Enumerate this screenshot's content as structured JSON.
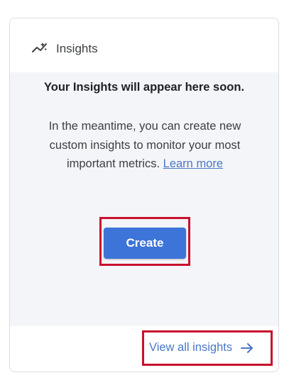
{
  "header": {
    "title": "Insights",
    "icon": "insights-trend-icon"
  },
  "empty_state": {
    "title": "Your Insights will appear here soon.",
    "description": "In the meantime, you can create new custom insights to monitor your most important metrics.",
    "learn_more_label": "Learn more"
  },
  "create_button": {
    "label": "Create"
  },
  "footer": {
    "view_all_label": "View all insights",
    "arrow_icon": "arrow-right-icon"
  },
  "colors": {
    "accent": "#3d74d8",
    "link": "#4a76c8",
    "highlight": "#c8102e",
    "body_bg": "#f4f5f8"
  }
}
